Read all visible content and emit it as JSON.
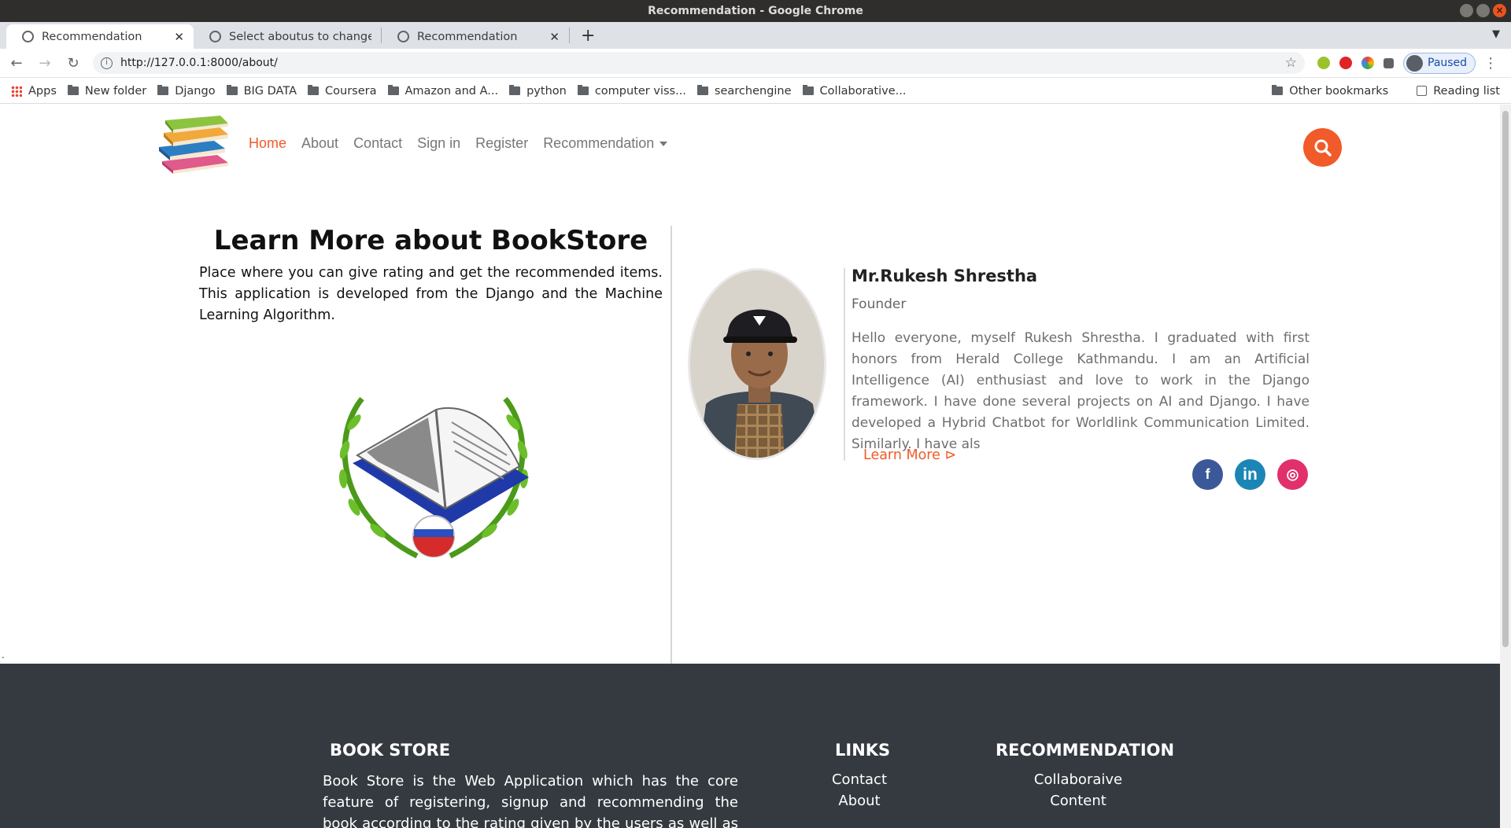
{
  "window": {
    "title": "Recommendation - Google Chrome"
  },
  "tabs": [
    {
      "title": "Recommendation"
    },
    {
      "title": "Select aboutus to change"
    },
    {
      "title": "Recommendation"
    }
  ],
  "toolbar": {
    "url": "http://127.0.0.1:8000/about/",
    "profile_label": "Paused"
  },
  "bookmarks": {
    "items": [
      "Apps",
      "New folder",
      "Django",
      "BIG DATA",
      "Coursera",
      "Amazon and A...",
      "python",
      "computer viss...",
      "searchengine",
      "Collaborative..."
    ],
    "other": "Other bookmarks",
    "reading_list": "Reading list"
  },
  "nav": {
    "links": [
      "Home",
      "About",
      "Contact",
      "Sign in",
      "Register",
      "Recommendation"
    ]
  },
  "about": {
    "title": "Learn More about BookStore",
    "description": "Place where you can give rating and get the recommended items. This application is developed from the Django and the Machine Learning Algorithm."
  },
  "founder": {
    "name": "Mr.Rukesh Shrestha",
    "role": "Founder",
    "bio": "Hello everyone, myself Rukesh Shrestha. I graduated with first honors from Herald College Kathmandu. I am an Artificial Intelligence (AI) enthusiast and love to work in the Django framework. I have done several projects on AI and Django. I have developed a Hybrid Chatbot for Worldlink Communication Limited. Similarly. I have als",
    "learn_more": "Learn More ⊳",
    "social": [
      "f",
      "in",
      "◎"
    ]
  },
  "stray_text": ".",
  "footer": {
    "bookstore_title": "BOOK STORE",
    "bookstore_desc": "Book Store is the Web Application which has the core feature of registering, signup and recommending the book according to the rating given by the users as well as by searching the content.",
    "links_title": "LINKS",
    "links": [
      "Contact",
      "About"
    ],
    "rec_title": "RECOMMENDATION",
    "rec_links": [
      "Collaboraive",
      "Content"
    ]
  },
  "colors": {
    "accent": "#f15a29",
    "footer_bg": "#343a40"
  }
}
